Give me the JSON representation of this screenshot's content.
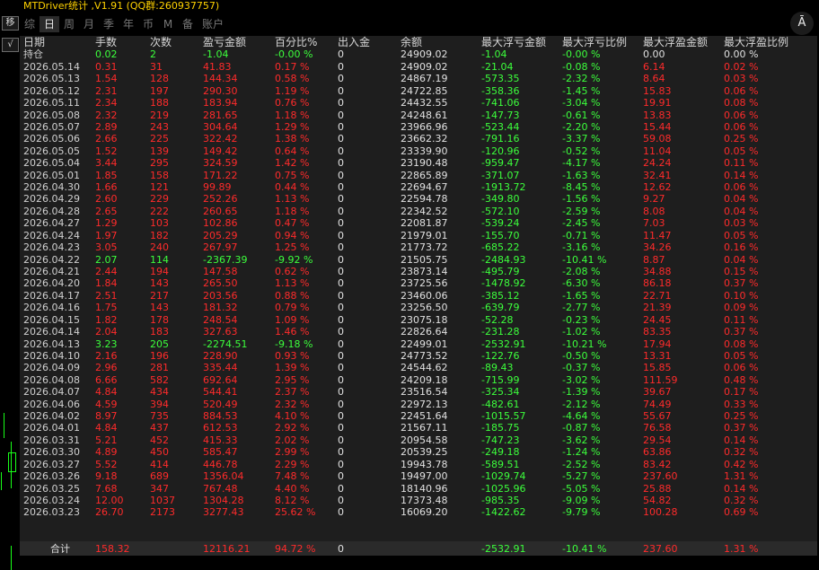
{
  "window": {
    "title": "MTDriver统计 ,V1.91 (QQ群:260937757)"
  },
  "rail": {
    "btn1": "移",
    "btn2": "√"
  },
  "tabs": [
    "综",
    "日",
    "周",
    "月",
    "季",
    "年",
    "币",
    "M",
    "备",
    "账户"
  ],
  "corner_icon": "Ā",
  "columns": [
    "日期",
    "手数",
    "次数",
    "盈亏金额",
    "百分比%",
    "出入金",
    "余额",
    "最大浮亏金额",
    "最大浮亏比例",
    "最大浮盈金额",
    "最大浮盈比例"
  ],
  "position_row": {
    "label": "持仓",
    "lots": "0.02",
    "count": "2",
    "pnl": "-1.04",
    "pct": "-0.00 %",
    "flow": "0",
    "balance": "24909.02",
    "max_loss": "-1.04",
    "max_loss_pct": "-0.00 %",
    "max_gain": "0.00",
    "max_gain_pct": "0.00 %"
  },
  "rows": [
    [
      "2026.05.14",
      "0.31",
      "31",
      "41.83",
      "0.17 %",
      "0",
      "24909.02",
      "-21.04",
      "-0.08 %",
      "6.14",
      "0.02 %"
    ],
    [
      "2026.05.13",
      "1.54",
      "128",
      "144.34",
      "0.58 %",
      "0",
      "24867.19",
      "-573.35",
      "-2.32 %",
      "8.64",
      "0.03 %"
    ],
    [
      "2026.05.12",
      "2.31",
      "197",
      "290.30",
      "1.19 %",
      "0",
      "24722.85",
      "-358.36",
      "-1.45 %",
      "15.83",
      "0.06 %"
    ],
    [
      "2026.05.11",
      "2.34",
      "188",
      "183.94",
      "0.76 %",
      "0",
      "24432.55",
      "-741.06",
      "-3.04 %",
      "19.91",
      "0.08 %"
    ],
    [
      "2026.05.08",
      "2.32",
      "219",
      "281.65",
      "1.18 %",
      "0",
      "24248.61",
      "-147.73",
      "-0.61 %",
      "13.83",
      "0.06 %"
    ],
    [
      "2026.05.07",
      "2.89",
      "243",
      "304.64",
      "1.29 %",
      "0",
      "23966.96",
      "-523.44",
      "-2.20 %",
      "15.44",
      "0.06 %"
    ],
    [
      "2026.05.06",
      "2.66",
      "225",
      "322.42",
      "1.38 %",
      "0",
      "23662.32",
      "-791.16",
      "-3.37 %",
      "59.08",
      "0.25 %"
    ],
    [
      "2026.05.05",
      "1.52",
      "139",
      "149.42",
      "0.64 %",
      "0",
      "23339.90",
      "-120.96",
      "-0.52 %",
      "11.04",
      "0.05 %"
    ],
    [
      "2026.05.04",
      "3.44",
      "295",
      "324.59",
      "1.42 %",
      "0",
      "23190.48",
      "-959.47",
      "-4.17 %",
      "24.24",
      "0.11 %"
    ],
    [
      "2026.05.01",
      "1.85",
      "158",
      "171.22",
      "0.75 %",
      "0",
      "22865.89",
      "-371.07",
      "-1.63 %",
      "32.41",
      "0.14 %"
    ],
    [
      "2026.04.30",
      "1.66",
      "121",
      "99.89",
      "0.44 %",
      "0",
      "22694.67",
      "-1913.72",
      "-8.45 %",
      "12.62",
      "0.06 %"
    ],
    [
      "2026.04.29",
      "2.60",
      "229",
      "252.26",
      "1.13 %",
      "0",
      "22594.78",
      "-349.80",
      "-1.56 %",
      "9.27",
      "0.04 %"
    ],
    [
      "2026.04.28",
      "2.65",
      "222",
      "260.65",
      "1.18 %",
      "0",
      "22342.52",
      "-572.10",
      "-2.59 %",
      "8.08",
      "0.04 %"
    ],
    [
      "2026.04.27",
      "1.29",
      "103",
      "102.86",
      "0.47 %",
      "0",
      "22081.87",
      "-539.24",
      "-2.45 %",
      "7.03",
      "0.03 %"
    ],
    [
      "2026.04.24",
      "1.97",
      "182",
      "205.29",
      "0.94 %",
      "0",
      "21979.01",
      "-155.70",
      "-0.71 %",
      "11.47",
      "0.05 %"
    ],
    [
      "2026.04.23",
      "3.05",
      "240",
      "267.97",
      "1.25 %",
      "0",
      "21773.72",
      "-685.22",
      "-3.16 %",
      "34.26",
      "0.16 %"
    ],
    [
      "2026.04.22",
      "2.07",
      "114",
      "-2367.39",
      "-9.92 %",
      "0",
      "21505.75",
      "-2484.93",
      "-10.41 %",
      "8.87",
      "0.04 %"
    ],
    [
      "2026.04.21",
      "2.44",
      "194",
      "147.58",
      "0.62 %",
      "0",
      "23873.14",
      "-495.79",
      "-2.08 %",
      "34.88",
      "0.15 %"
    ],
    [
      "2026.04.20",
      "1.84",
      "143",
      "265.50",
      "1.13 %",
      "0",
      "23725.56",
      "-1478.92",
      "-6.30 %",
      "86.18",
      "0.37 %"
    ],
    [
      "2026.04.17",
      "2.51",
      "217",
      "203.56",
      "0.88 %",
      "0",
      "23460.06",
      "-385.12",
      "-1.65 %",
      "22.71",
      "0.10 %"
    ],
    [
      "2026.04.16",
      "1.75",
      "143",
      "181.32",
      "0.79 %",
      "0",
      "23256.50",
      "-639.79",
      "-2.77 %",
      "21.39",
      "0.09 %"
    ],
    [
      "2026.04.15",
      "1.82",
      "178",
      "248.54",
      "1.09 %",
      "0",
      "23075.18",
      "-52.28",
      "-0.23 %",
      "24.45",
      "0.11 %"
    ],
    [
      "2026.04.14",
      "2.04",
      "183",
      "327.63",
      "1.46 %",
      "0",
      "22826.64",
      "-231.28",
      "-1.02 %",
      "83.35",
      "0.37 %"
    ],
    [
      "2026.04.13",
      "3.23",
      "205",
      "-2274.51",
      "-9.18 %",
      "0",
      "22499.01",
      "-2532.91",
      "-10.21 %",
      "17.94",
      "0.08 %"
    ],
    [
      "2026.04.10",
      "2.16",
      "196",
      "228.90",
      "0.93 %",
      "0",
      "24773.52",
      "-122.76",
      "-0.50 %",
      "13.31",
      "0.05 %"
    ],
    [
      "2026.04.09",
      "2.96",
      "281",
      "335.44",
      "1.39 %",
      "0",
      "24544.62",
      "-89.43",
      "-0.37 %",
      "15.85",
      "0.06 %"
    ],
    [
      "2026.04.08",
      "6.66",
      "582",
      "692.64",
      "2.95 %",
      "0",
      "24209.18",
      "-715.99",
      "-3.02 %",
      "111.59",
      "0.48 %"
    ],
    [
      "2026.04.07",
      "4.84",
      "434",
      "544.41",
      "2.37 %",
      "0",
      "23516.54",
      "-325.34",
      "-1.39 %",
      "39.67",
      "0.17 %"
    ],
    [
      "2026.04.06",
      "4.59",
      "394",
      "520.49",
      "2.32 %",
      "0",
      "22972.13",
      "-482.61",
      "-2.12 %",
      "74.49",
      "0.33 %"
    ],
    [
      "2026.04.02",
      "8.97",
      "735",
      "884.53",
      "4.10 %",
      "0",
      "22451.64",
      "-1015.57",
      "-4.64 %",
      "55.67",
      "0.25 %"
    ],
    [
      "2026.04.01",
      "4.84",
      "437",
      "612.53",
      "2.92 %",
      "0",
      "21567.11",
      "-185.75",
      "-0.87 %",
      "76.58",
      "0.37 %"
    ],
    [
      "2026.03.31",
      "5.21",
      "452",
      "415.33",
      "2.02 %",
      "0",
      "20954.58",
      "-747.23",
      "-3.62 %",
      "29.54",
      "0.14 %"
    ],
    [
      "2026.03.30",
      "4.89",
      "450",
      "585.47",
      "2.99 %",
      "0",
      "20539.25",
      "-249.18",
      "-1.24 %",
      "63.86",
      "0.32 %"
    ],
    [
      "2026.03.27",
      "5.52",
      "414",
      "446.78",
      "2.29 %",
      "0",
      "19943.78",
      "-589.51",
      "-2.52 %",
      "83.42",
      "0.42 %"
    ],
    [
      "2026.03.26",
      "9.18",
      "689",
      "1356.04",
      "7.48 %",
      "0",
      "19497.00",
      "-1029.74",
      "-5.27 %",
      "237.60",
      "1.31 %"
    ],
    [
      "2026.03.25",
      "7.68",
      "347",
      "767.48",
      "4.40 %",
      "0",
      "18140.96",
      "-1025.96",
      "-5.05 %",
      "25.88",
      "0.14 %"
    ],
    [
      "2026.03.24",
      "12.00",
      "1037",
      "1304.28",
      "8.12 %",
      "0",
      "17373.48",
      "-985.35",
      "-9.09 %",
      "54.82",
      "0.32 %"
    ],
    [
      "2026.03.23",
      "26.70",
      "2173",
      "3277.43",
      "25.62 %",
      "0",
      "16069.20",
      "-1422.62",
      "-9.79 %",
      "100.28",
      "0.69 %"
    ]
  ],
  "total": {
    "label": "合计",
    "lots": "158.32",
    "pnl": "12116.21",
    "pct": "94.72 %",
    "flow": "0",
    "max_loss": "-2532.91",
    "max_loss_pct": "-10.41 %",
    "max_gain": "237.60",
    "max_gain_pct": "1.31 %"
  },
  "colors": {
    "gain": "#ff2b2b",
    "loss": "#3cff3c",
    "title": "#ffd200"
  }
}
